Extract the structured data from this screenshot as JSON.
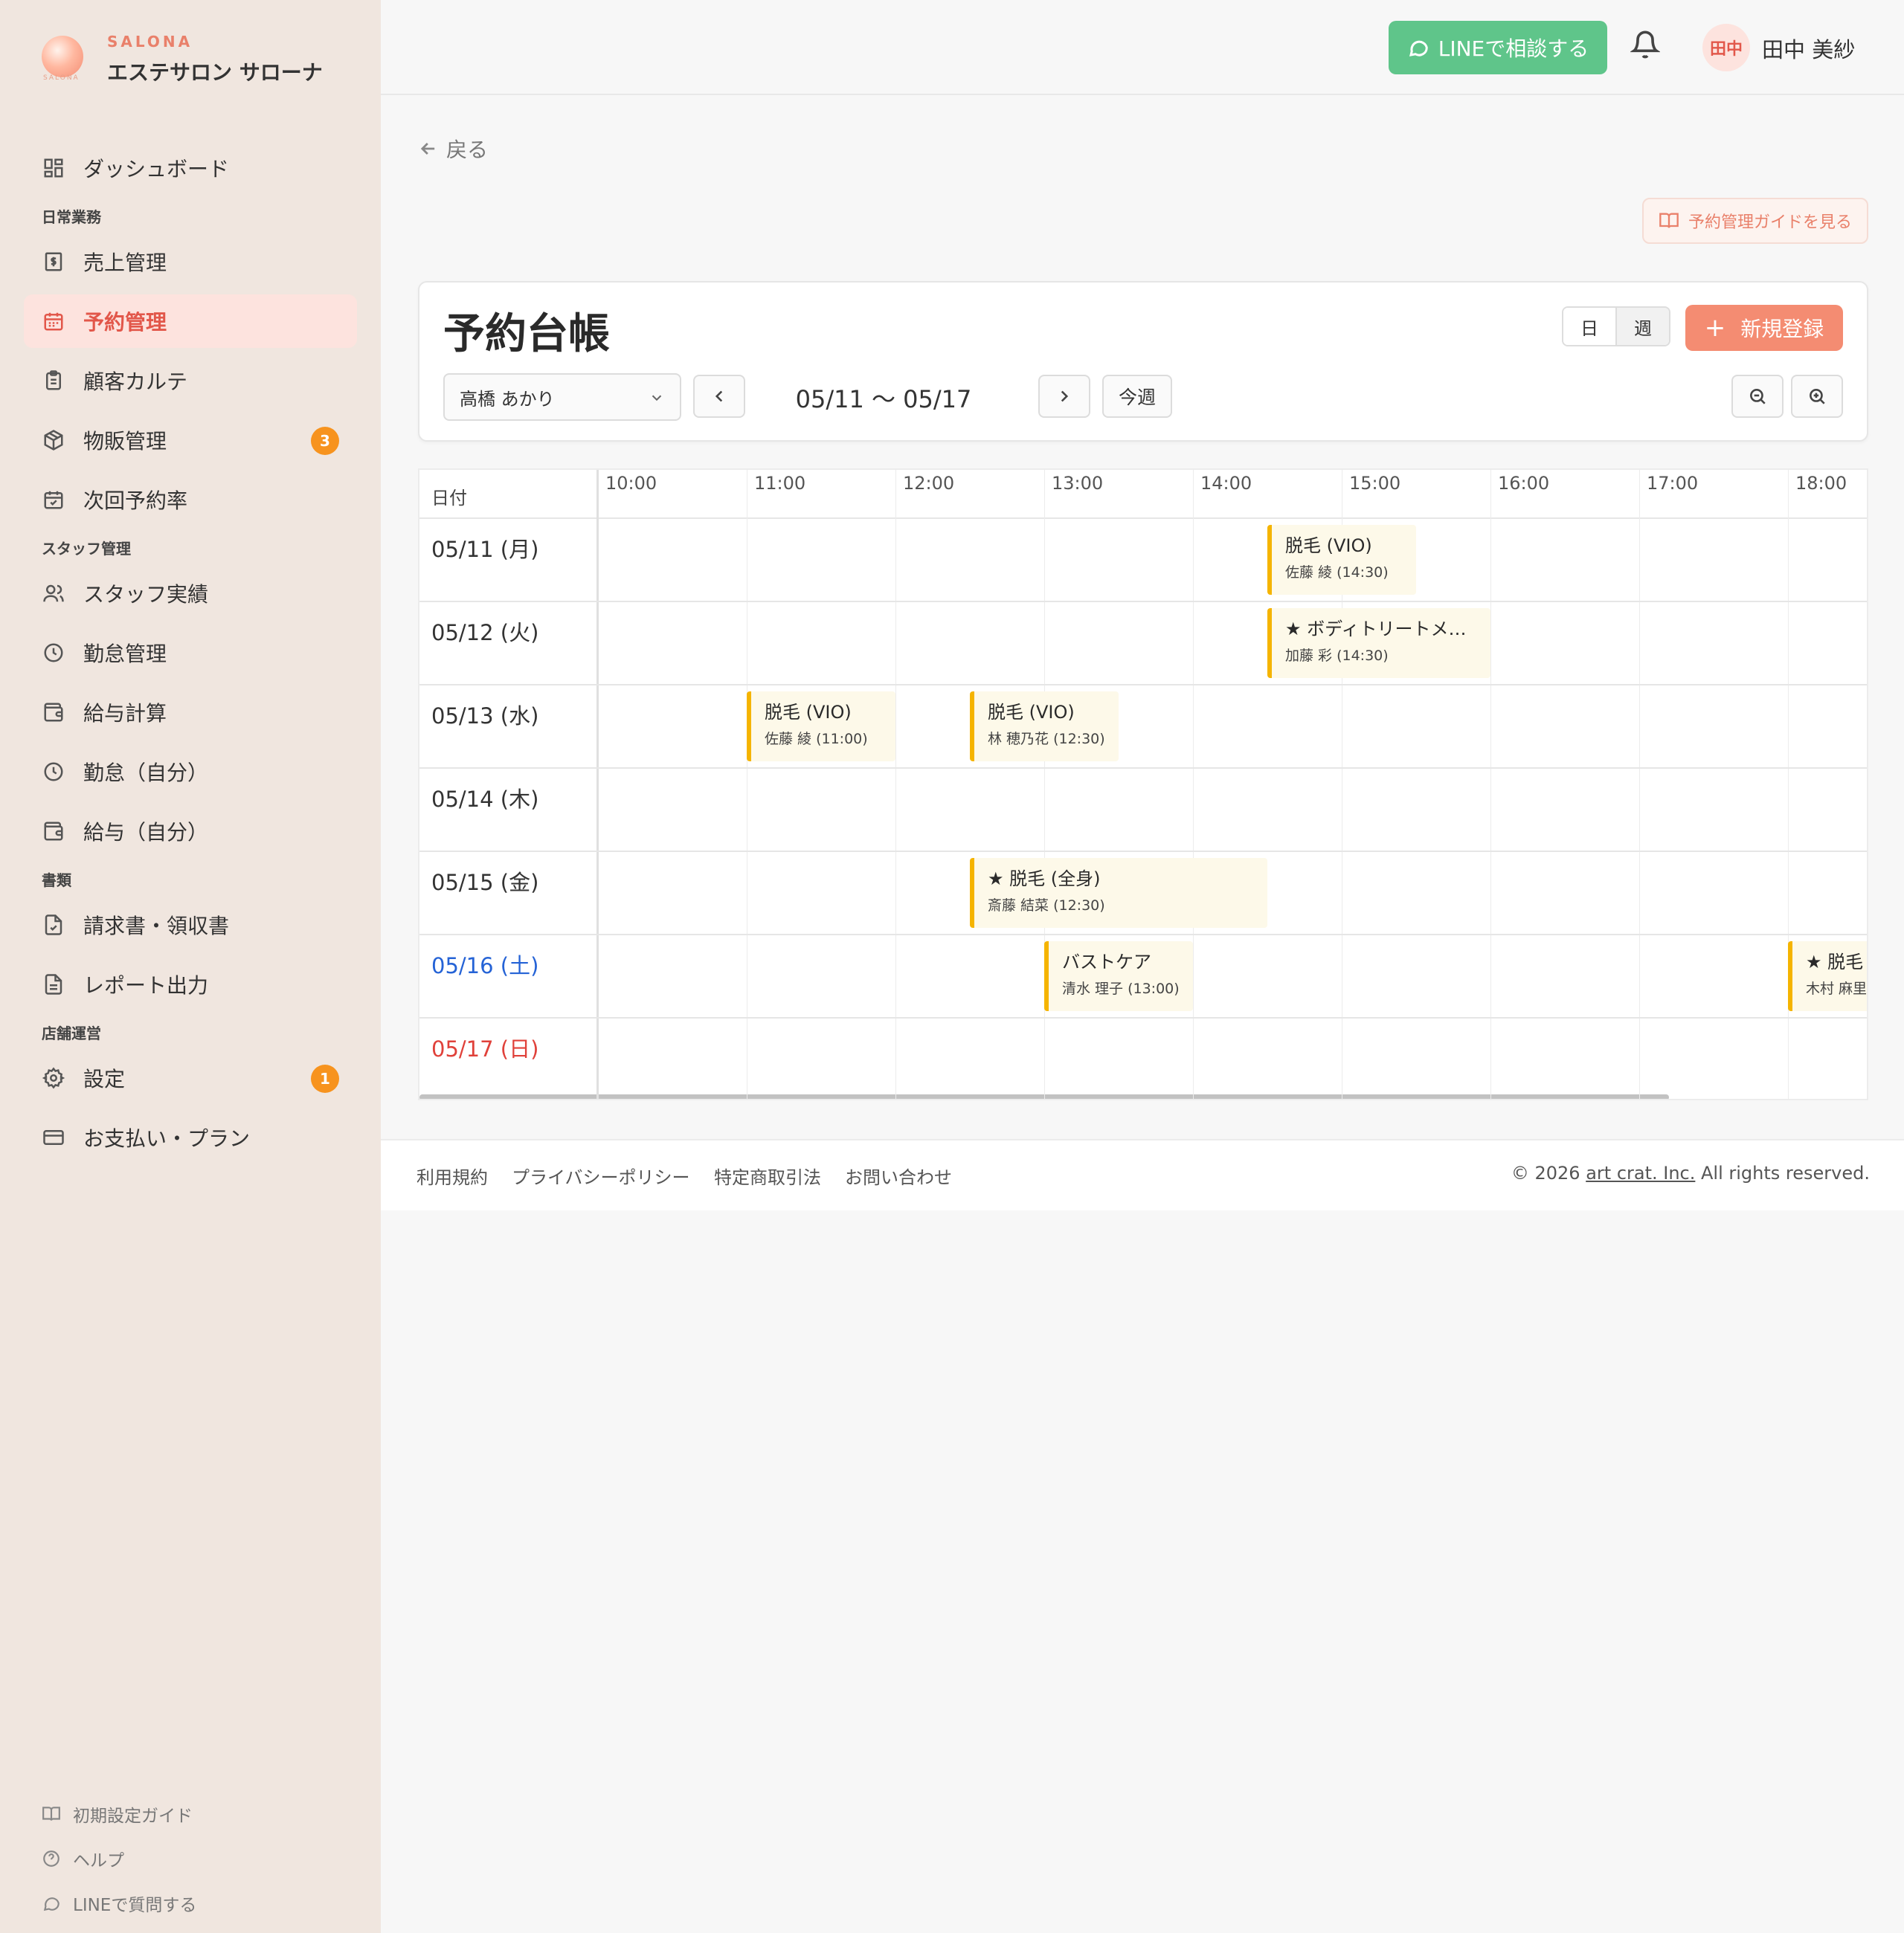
{
  "brand": {
    "kicker": "SALONA",
    "logo_sub": "SALONA",
    "name": "エステサロン サローナ"
  },
  "nav": {
    "dashboard": "ダッシュボード",
    "section_daily": "日常業務",
    "sales": "売上管理",
    "reservations": "予約管理",
    "customers": "顧客カルテ",
    "retail": "物販管理",
    "retail_badge": "3",
    "next_rate": "次回予約率",
    "section_staff": "スタッフ管理",
    "staff_perf": "スタッフ実績",
    "attendance": "勤怠管理",
    "payroll": "給与計算",
    "attendance_self": "勤怠（自分）",
    "payroll_self": "給与（自分）",
    "section_docs": "書類",
    "invoices": "請求書・領収書",
    "reports": "レポート出力",
    "section_store": "店舗運営",
    "settings": "設定",
    "settings_badge": "1",
    "billing": "お支払い・プラン"
  },
  "side_bottom": {
    "setup_guide": "初期設定ガイド",
    "help": "ヘルプ",
    "line_question": "LINEで質問する"
  },
  "header": {
    "line_button": "LINEで相談する",
    "avatar_initials": "田中",
    "user_name": "田中 美紗"
  },
  "main": {
    "back": "戻る",
    "guide_button": "予約管理ガイドを見る",
    "title": "予約台帳",
    "view_day": "日",
    "view_week": "週",
    "new_button": "新規登録",
    "staff_selected": "高橋 あかり",
    "date_range": "05/11 〜 05/17",
    "this_week": "今週"
  },
  "calendar": {
    "date_header": "日付",
    "times": [
      "10:00",
      "11:00",
      "12:00",
      "13:00",
      "14:00",
      "15:00",
      "16:00",
      "17:00",
      "18:00"
    ],
    "days": [
      {
        "label": "05/11 (月)",
        "type": "weekday"
      },
      {
        "label": "05/12 (火)",
        "type": "weekday"
      },
      {
        "label": "05/13 (水)",
        "type": "weekday"
      },
      {
        "label": "05/14 (木)",
        "type": "weekday"
      },
      {
        "label": "05/15 (金)",
        "type": "weekday"
      },
      {
        "label": "05/16 (土)",
        "type": "sat"
      },
      {
        "label": "05/17 (日)",
        "type": "sun"
      }
    ],
    "appointments": [
      {
        "day": 0,
        "start": "14:30",
        "end": "15:30",
        "title": "脱毛 (VIO)",
        "detail": "佐藤 綾 (14:30)"
      },
      {
        "day": 1,
        "start": "14:30",
        "end": "16:00",
        "title": "★ ボディトリートメ…",
        "detail": "加藤 彩 (14:30)"
      },
      {
        "day": 2,
        "start": "11:00",
        "end": "12:00",
        "title": "脱毛 (VIO)",
        "detail": "佐藤 綾 (11:00)"
      },
      {
        "day": 2,
        "start": "12:30",
        "end": "13:30",
        "title": "脱毛 (VIO)",
        "detail": "林 穂乃花 (12:30)"
      },
      {
        "day": 4,
        "start": "12:30",
        "end": "14:30",
        "title": "★ 脱毛 (全身)",
        "detail": "斎藤 結菜 (12:30)"
      },
      {
        "day": 5,
        "start": "13:00",
        "end": "14:00",
        "title": "バストケア",
        "detail": "清水 理子 (13:00)"
      },
      {
        "day": 5,
        "start": "18:00",
        "end": "19:00",
        "title": "★ 脱毛",
        "detail": "木村 麻里"
      }
    ],
    "accent_color": "#f5b400"
  },
  "footer": {
    "terms": "利用規約",
    "privacy": "プライバシーポリシー",
    "commerce": "特定商取引法",
    "contact": "お問い合わせ",
    "copyright_prefix": "© 2026",
    "company": "art crat. Inc.",
    "copyright_suffix": "All rights reserved."
  },
  "colors": {
    "brand": "#e9806a",
    "primary_button": "#f48c72",
    "line_green": "#5fc58a",
    "badge": "#f7931e",
    "saturday": "#2563d6",
    "sunday": "#e0413a"
  }
}
